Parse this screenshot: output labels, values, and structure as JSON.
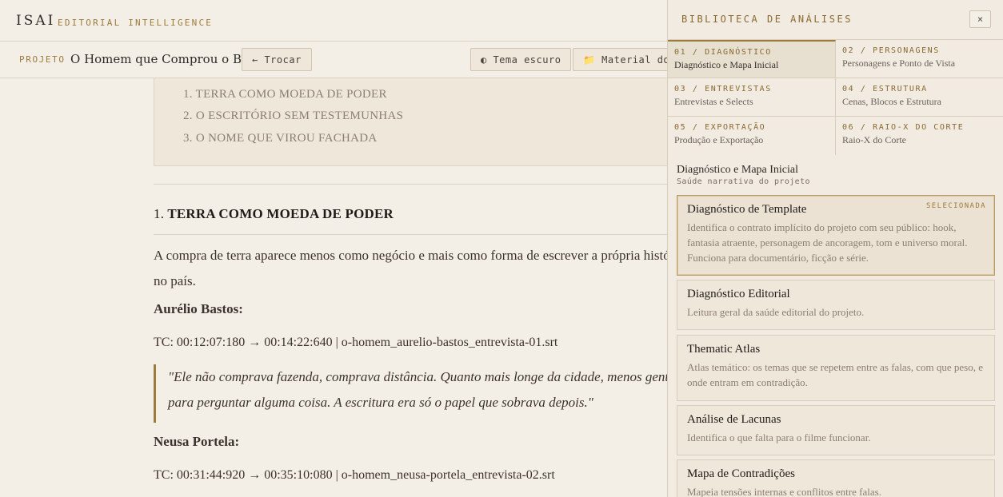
{
  "app": {
    "logo": "ISAI",
    "tagline": "EDITORIAL INTELLIGENCE"
  },
  "project": {
    "label": "PROJETO",
    "name": "O Homem que Comprou o Brasil",
    "switch_label": "← Trocar",
    "theme_label": "◐ Tema escuro",
    "material_label": "📁 Material do"
  },
  "document": {
    "toc": [
      "1. TERRA COMO MOEDA DE PODER",
      "2. O ESCRITÓRIO SEM TESTEMUNHAS",
      "3. O NOME QUE VIROU FACHADA"
    ],
    "section_number": "1.",
    "section_title": "TERRA COMO MOEDA DE PODER",
    "paragraph": "A compra de terra aparece menos como negócio e mais como forma de escrever a própria história no país.",
    "speaker_1": "Aurélio Bastos:",
    "tc_1": "TC: 00:12:07:180 → 00:14:22:640 | o-homem_aurelio-bastos_entrevista-01.srt",
    "quote_1": "\"Ele não comprava fazenda, comprava distância. Quanto mais longe da cidade, menos gente para perguntar alguma coisa. A escritura era só o papel que sobrava depois.\"",
    "speaker_2": "Neusa Portela:",
    "tc_2": "TC: 00:31:44:920 → 00:35:10:080 | o-homem_neusa-portela_entrevista-02.srt"
  },
  "panel": {
    "title": "BIBLIOTECA DE ANÁLISES",
    "close_label": "×",
    "categories": [
      {
        "num": "01 / DIAGNÓSTICO",
        "label": "Diagnóstico e Mapa Inicial"
      },
      {
        "num": "02 / PERSONAGENS",
        "label": "Personagens e Ponto de Vista"
      },
      {
        "num": "03 / ENTREVISTAS",
        "label": "Entrevistas e Selects"
      },
      {
        "num": "04 / ESTRUTURA",
        "label": "Cenas, Blocos e Estrutura"
      },
      {
        "num": "05 / EXPORTAÇÃO",
        "label": "Produção e Exportação"
      },
      {
        "num": "06 / RAIO-X DO CORTE",
        "label": "Raio-X do Corte"
      }
    ],
    "section_title": "Diagnóstico e Mapa Inicial",
    "section_desc": "Saúde narrativa do projeto",
    "selected_badge": "SELECIONADA",
    "analyses": [
      {
        "title": "Diagnóstico de Template",
        "desc": "Identifica o contrato implícito do projeto com seu público: hook, fantasia atraente, personagem de ancoragem, tom e universo moral. Funciona para documentário, ficção e série."
      },
      {
        "title": "Diagnóstico Editorial",
        "desc": "Leitura geral da saúde editorial do projeto."
      },
      {
        "title": "Thematic Atlas",
        "desc": "Atlas temático: os temas que se repetem entre as falas, com que peso, e onde entram em contradição."
      },
      {
        "title": "Análise de Lacunas",
        "desc": "Identifica o que falta para o filme funcionar."
      },
      {
        "title": "Mapa de Contradições",
        "desc": "Mapeia tensões internas e conflitos entre falas."
      }
    ]
  },
  "colors": {
    "background": "#f4efe6",
    "accent": "#9c7b3d",
    "panel": "#f1ebe1"
  }
}
